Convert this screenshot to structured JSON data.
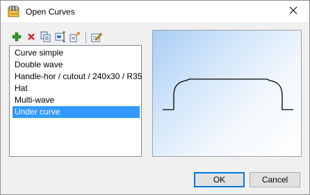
{
  "window": {
    "title": "Open Curves",
    "title_icon": "curves-app-icon",
    "close_icon": "close-icon"
  },
  "toolbar": {
    "buttons": [
      {
        "name": "add",
        "icon": "plus-icon"
      },
      {
        "name": "delete",
        "icon": "delete-x-icon"
      },
      {
        "name": "copy",
        "icon": "copy-icon"
      },
      {
        "name": "rename",
        "icon": "rename-icon"
      },
      {
        "name": "export",
        "icon": "export-icon"
      },
      {
        "name": "edit",
        "icon": "edit-pencil-icon"
      }
    ]
  },
  "curves": {
    "items": [
      "Curve simple",
      "Double wave",
      "Handle-hor / cutout / 240x30 / R35",
      "Hat",
      "Multi-wave",
      "Under curve"
    ],
    "selected_index": 5
  },
  "buttons": {
    "ok": "OK",
    "cancel": "Cancel"
  },
  "colors": {
    "selection": "#3399ff",
    "accent": "#0078d7",
    "add_icon": "#2e9e2e",
    "delete_icon": "#e02020"
  }
}
